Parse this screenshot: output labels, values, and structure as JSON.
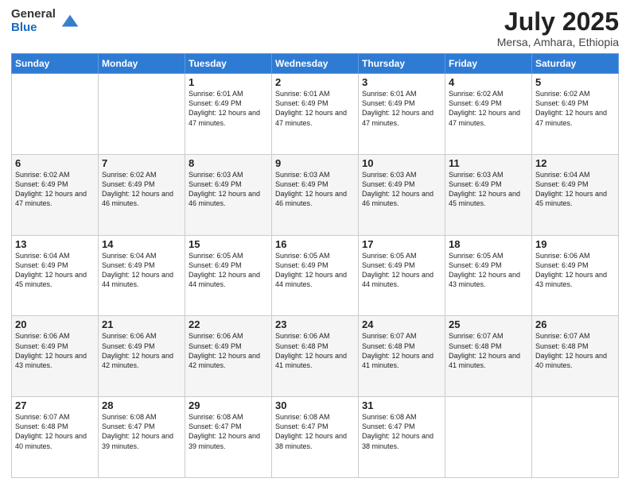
{
  "logo": {
    "general": "General",
    "blue": "Blue"
  },
  "header": {
    "month": "July 2025",
    "location": "Mersa, Amhara, Ethiopia"
  },
  "weekdays": [
    "Sunday",
    "Monday",
    "Tuesday",
    "Wednesday",
    "Thursday",
    "Friday",
    "Saturday"
  ],
  "weeks": [
    [
      {
        "day": "",
        "sunrise": "",
        "sunset": "",
        "daylight": ""
      },
      {
        "day": "",
        "sunrise": "",
        "sunset": "",
        "daylight": ""
      },
      {
        "day": "1",
        "sunrise": "Sunrise: 6:01 AM",
        "sunset": "Sunset: 6:49 PM",
        "daylight": "Daylight: 12 hours and 47 minutes."
      },
      {
        "day": "2",
        "sunrise": "Sunrise: 6:01 AM",
        "sunset": "Sunset: 6:49 PM",
        "daylight": "Daylight: 12 hours and 47 minutes."
      },
      {
        "day": "3",
        "sunrise": "Sunrise: 6:01 AM",
        "sunset": "Sunset: 6:49 PM",
        "daylight": "Daylight: 12 hours and 47 minutes."
      },
      {
        "day": "4",
        "sunrise": "Sunrise: 6:02 AM",
        "sunset": "Sunset: 6:49 PM",
        "daylight": "Daylight: 12 hours and 47 minutes."
      },
      {
        "day": "5",
        "sunrise": "Sunrise: 6:02 AM",
        "sunset": "Sunset: 6:49 PM",
        "daylight": "Daylight: 12 hours and 47 minutes."
      }
    ],
    [
      {
        "day": "6",
        "sunrise": "Sunrise: 6:02 AM",
        "sunset": "Sunset: 6:49 PM",
        "daylight": "Daylight: 12 hours and 47 minutes."
      },
      {
        "day": "7",
        "sunrise": "Sunrise: 6:02 AM",
        "sunset": "Sunset: 6:49 PM",
        "daylight": "Daylight: 12 hours and 46 minutes."
      },
      {
        "day": "8",
        "sunrise": "Sunrise: 6:03 AM",
        "sunset": "Sunset: 6:49 PM",
        "daylight": "Daylight: 12 hours and 46 minutes."
      },
      {
        "day": "9",
        "sunrise": "Sunrise: 6:03 AM",
        "sunset": "Sunset: 6:49 PM",
        "daylight": "Daylight: 12 hours and 46 minutes."
      },
      {
        "day": "10",
        "sunrise": "Sunrise: 6:03 AM",
        "sunset": "Sunset: 6:49 PM",
        "daylight": "Daylight: 12 hours and 46 minutes."
      },
      {
        "day": "11",
        "sunrise": "Sunrise: 6:03 AM",
        "sunset": "Sunset: 6:49 PM",
        "daylight": "Daylight: 12 hours and 45 minutes."
      },
      {
        "day": "12",
        "sunrise": "Sunrise: 6:04 AM",
        "sunset": "Sunset: 6:49 PM",
        "daylight": "Daylight: 12 hours and 45 minutes."
      }
    ],
    [
      {
        "day": "13",
        "sunrise": "Sunrise: 6:04 AM",
        "sunset": "Sunset: 6:49 PM",
        "daylight": "Daylight: 12 hours and 45 minutes."
      },
      {
        "day": "14",
        "sunrise": "Sunrise: 6:04 AM",
        "sunset": "Sunset: 6:49 PM",
        "daylight": "Daylight: 12 hours and 44 minutes."
      },
      {
        "day": "15",
        "sunrise": "Sunrise: 6:05 AM",
        "sunset": "Sunset: 6:49 PM",
        "daylight": "Daylight: 12 hours and 44 minutes."
      },
      {
        "day": "16",
        "sunrise": "Sunrise: 6:05 AM",
        "sunset": "Sunset: 6:49 PM",
        "daylight": "Daylight: 12 hours and 44 minutes."
      },
      {
        "day": "17",
        "sunrise": "Sunrise: 6:05 AM",
        "sunset": "Sunset: 6:49 PM",
        "daylight": "Daylight: 12 hours and 44 minutes."
      },
      {
        "day": "18",
        "sunrise": "Sunrise: 6:05 AM",
        "sunset": "Sunset: 6:49 PM",
        "daylight": "Daylight: 12 hours and 43 minutes."
      },
      {
        "day": "19",
        "sunrise": "Sunrise: 6:06 AM",
        "sunset": "Sunset: 6:49 PM",
        "daylight": "Daylight: 12 hours and 43 minutes."
      }
    ],
    [
      {
        "day": "20",
        "sunrise": "Sunrise: 6:06 AM",
        "sunset": "Sunset: 6:49 PM",
        "daylight": "Daylight: 12 hours and 43 minutes."
      },
      {
        "day": "21",
        "sunrise": "Sunrise: 6:06 AM",
        "sunset": "Sunset: 6:49 PM",
        "daylight": "Daylight: 12 hours and 42 minutes."
      },
      {
        "day": "22",
        "sunrise": "Sunrise: 6:06 AM",
        "sunset": "Sunset: 6:49 PM",
        "daylight": "Daylight: 12 hours and 42 minutes."
      },
      {
        "day": "23",
        "sunrise": "Sunrise: 6:06 AM",
        "sunset": "Sunset: 6:48 PM",
        "daylight": "Daylight: 12 hours and 41 minutes."
      },
      {
        "day": "24",
        "sunrise": "Sunrise: 6:07 AM",
        "sunset": "Sunset: 6:48 PM",
        "daylight": "Daylight: 12 hours and 41 minutes."
      },
      {
        "day": "25",
        "sunrise": "Sunrise: 6:07 AM",
        "sunset": "Sunset: 6:48 PM",
        "daylight": "Daylight: 12 hours and 41 minutes."
      },
      {
        "day": "26",
        "sunrise": "Sunrise: 6:07 AM",
        "sunset": "Sunset: 6:48 PM",
        "daylight": "Daylight: 12 hours and 40 minutes."
      }
    ],
    [
      {
        "day": "27",
        "sunrise": "Sunrise: 6:07 AM",
        "sunset": "Sunset: 6:48 PM",
        "daylight": "Daylight: 12 hours and 40 minutes."
      },
      {
        "day": "28",
        "sunrise": "Sunrise: 6:08 AM",
        "sunset": "Sunset: 6:47 PM",
        "daylight": "Daylight: 12 hours and 39 minutes."
      },
      {
        "day": "29",
        "sunrise": "Sunrise: 6:08 AM",
        "sunset": "Sunset: 6:47 PM",
        "daylight": "Daylight: 12 hours and 39 minutes."
      },
      {
        "day": "30",
        "sunrise": "Sunrise: 6:08 AM",
        "sunset": "Sunset: 6:47 PM",
        "daylight": "Daylight: 12 hours and 38 minutes."
      },
      {
        "day": "31",
        "sunrise": "Sunrise: 6:08 AM",
        "sunset": "Sunset: 6:47 PM",
        "daylight": "Daylight: 12 hours and 38 minutes."
      },
      {
        "day": "",
        "sunrise": "",
        "sunset": "",
        "daylight": ""
      },
      {
        "day": "",
        "sunrise": "",
        "sunset": "",
        "daylight": ""
      }
    ]
  ]
}
